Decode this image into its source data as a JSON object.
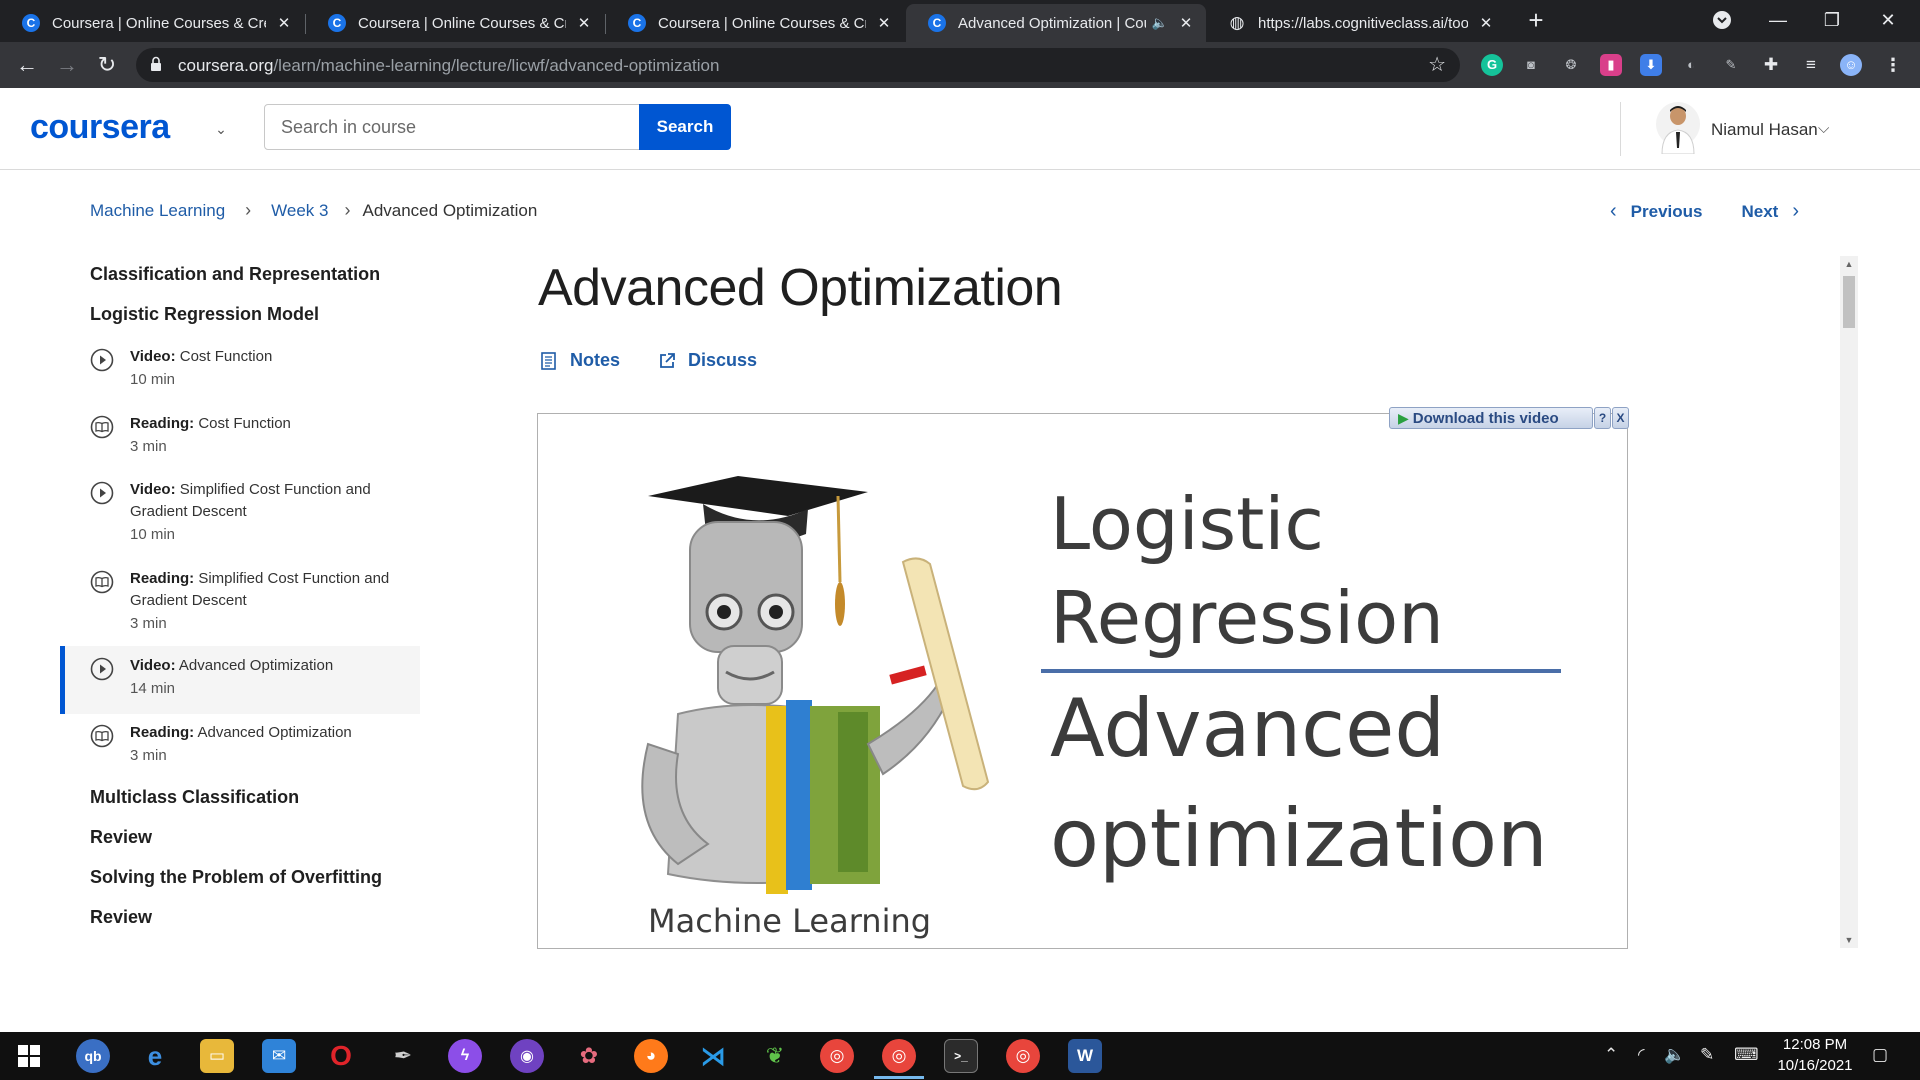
{
  "browser": {
    "tabs": [
      {
        "title": "Coursera | Online Courses & Credentials",
        "favicon": "C",
        "active": false
      },
      {
        "title": "Coursera | Online Courses & Credentials",
        "favicon": "C",
        "active": false
      },
      {
        "title": "Coursera | Online Courses & Credentials",
        "favicon": "C",
        "active": false
      },
      {
        "title": "Advanced Optimization | Coursera",
        "favicon": "C",
        "active": true
      },
      {
        "title": "https://labs.cognitiveclass.ai/tools",
        "favicon": "globe",
        "active": false
      }
    ],
    "url_host": "coursera.org",
    "url_path": "/learn/machine-learning/lecture/licwf/advanced-optimization"
  },
  "header": {
    "logo": "coursera",
    "search_placeholder": "Search in course",
    "search_button": "Search",
    "user_name": "Niamul Hasan"
  },
  "breadcrumb": {
    "items": [
      "Machine Learning",
      "Week 3"
    ],
    "current": "Advanced Optimization"
  },
  "nav": {
    "previous": "Previous",
    "next": "Next"
  },
  "sidebar": {
    "section_1": "Classification and Representation",
    "section_2": "Logistic Regression Model",
    "items": [
      {
        "type": "Video:",
        "title": "Cost Function",
        "duration": "10 min",
        "icon": "play-circle-icon"
      },
      {
        "type": "Reading:",
        "title": "Cost Function",
        "duration": "3 min",
        "icon": "book-icon"
      },
      {
        "type": "Video:",
        "title": "Simplified Cost Function and Gradient Descent",
        "duration": "10 min",
        "icon": "play-circle-icon"
      },
      {
        "type": "Reading:",
        "title": "Simplified Cost Function and Gradient Descent",
        "duration": "3 min",
        "icon": "book-icon"
      },
      {
        "type": "Video:",
        "title": "Advanced Optimization",
        "duration": "14 min",
        "icon": "play-circle-icon",
        "active": true
      },
      {
        "type": "Reading:",
        "title": "Advanced Optimization",
        "duration": "3 min",
        "icon": "book-icon"
      }
    ],
    "section_3": "Multiclass Classification",
    "section_4": "Review",
    "section_5": "Solving the Problem of Overfitting",
    "section_6": "Review"
  },
  "main": {
    "title": "Advanced Optimization",
    "notes": "Notes",
    "discuss": "Discuss",
    "download_label": "Download this video",
    "download_help": "?",
    "download_close": "X",
    "slide": {
      "line1": "Logistic",
      "line2": "Regression",
      "line3": "Advanced",
      "line4": "optimization",
      "caption": "Machine Learning"
    }
  },
  "taskbar": {
    "time": "12:08 PM",
    "date": "10/16/2021"
  },
  "colors": {
    "brand": "#0056d2",
    "link": "#1f5ca7",
    "chrome_dark": "#202124",
    "chrome_toolbar": "#35363a"
  }
}
